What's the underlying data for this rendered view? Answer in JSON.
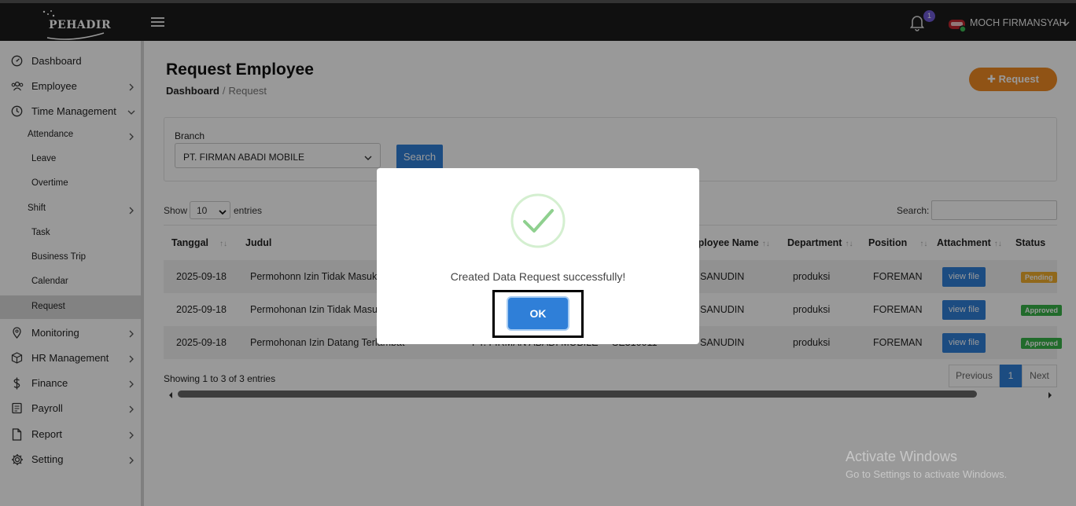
{
  "navbar": {
    "logo_text": "PEHADIR",
    "notification_count": "1",
    "user_name": "MOCH FIRMANSYAH"
  },
  "sidebar": {
    "items": [
      {
        "label": "Dashboard",
        "icon": "dashboard-icon"
      },
      {
        "label": "Employee",
        "icon": "users-icon"
      },
      {
        "label": "Time Management",
        "icon": "clock-icon"
      },
      {
        "label": "Attendance"
      },
      {
        "label": "Leave"
      },
      {
        "label": "Overtime"
      },
      {
        "label": "Shift"
      },
      {
        "label": "Task"
      },
      {
        "label": "Business Trip"
      },
      {
        "label": "Calendar"
      },
      {
        "label": "Request"
      },
      {
        "label": "Monitoring",
        "icon": "location-pin-icon"
      },
      {
        "label": "HR Management",
        "icon": "cube-icon"
      },
      {
        "label": "Finance",
        "icon": "dollar-icon"
      },
      {
        "label": "Payroll",
        "icon": "payroll-icon"
      },
      {
        "label": "Report",
        "icon": "document-icon"
      },
      {
        "label": "Setting",
        "icon": "gear-icon"
      }
    ]
  },
  "page": {
    "title": "Request Employee",
    "breadcrumb": [
      "Dashboard",
      "Request"
    ],
    "request_button": "Request"
  },
  "filter": {
    "branch_label": "Branch",
    "branch_value": "PT. FIRMAN ABADI MOBILE",
    "search_button": "Search"
  },
  "table_controls": {
    "show_label": "Show",
    "show_value": "10",
    "entries_label": "entries",
    "search_label": "Search:"
  },
  "table": {
    "headers": [
      "Tanggal",
      "Judul",
      "nployee Name",
      "Department",
      "Position",
      "Attachment",
      "Status"
    ],
    "rows": [
      {
        "tanggal": "2025-09-18",
        "judul": "Permohonn Izin Tidak Masuk K",
        "employee": "SANUDIN",
        "department": "produksi",
        "position": "FOREMAN",
        "attachment": "view file",
        "status": "Pending"
      },
      {
        "tanggal": "2025-09-18",
        "judul": "Permohonan Izin Tidak Masuk",
        "employee": "SANUDIN",
        "department": "produksi",
        "position": "FOREMAN",
        "attachment": "view file",
        "status": "Approved"
      },
      {
        "tanggal": "2025-09-18",
        "judul": "Permohonan Izin Datang Terlambat",
        "branch": "PT. FIRMAN ABADI MOBILE",
        "code": "SE310011",
        "employee": "SANUDIN",
        "department": "produksi",
        "position": "FOREMAN",
        "attachment": "view file",
        "status": "Approved"
      }
    ]
  },
  "pagination": {
    "info": "Showing 1 to 3 of 3 entries",
    "previous": "Previous",
    "current": "1",
    "next": "Next"
  },
  "modal": {
    "message": "Created Data Request successfully!",
    "ok_button": "OK"
  },
  "watermark": {
    "line1": "Activate Windows",
    "line2": "Go to Settings to activate Windows."
  },
  "colors": {
    "navbar": "#1b1b1b",
    "accent_orange": "#f08a24",
    "primary_blue": "#2f7fd8",
    "success_green": "#8fd08f",
    "pending": "#f0ad2e",
    "approved": "#38b249"
  }
}
